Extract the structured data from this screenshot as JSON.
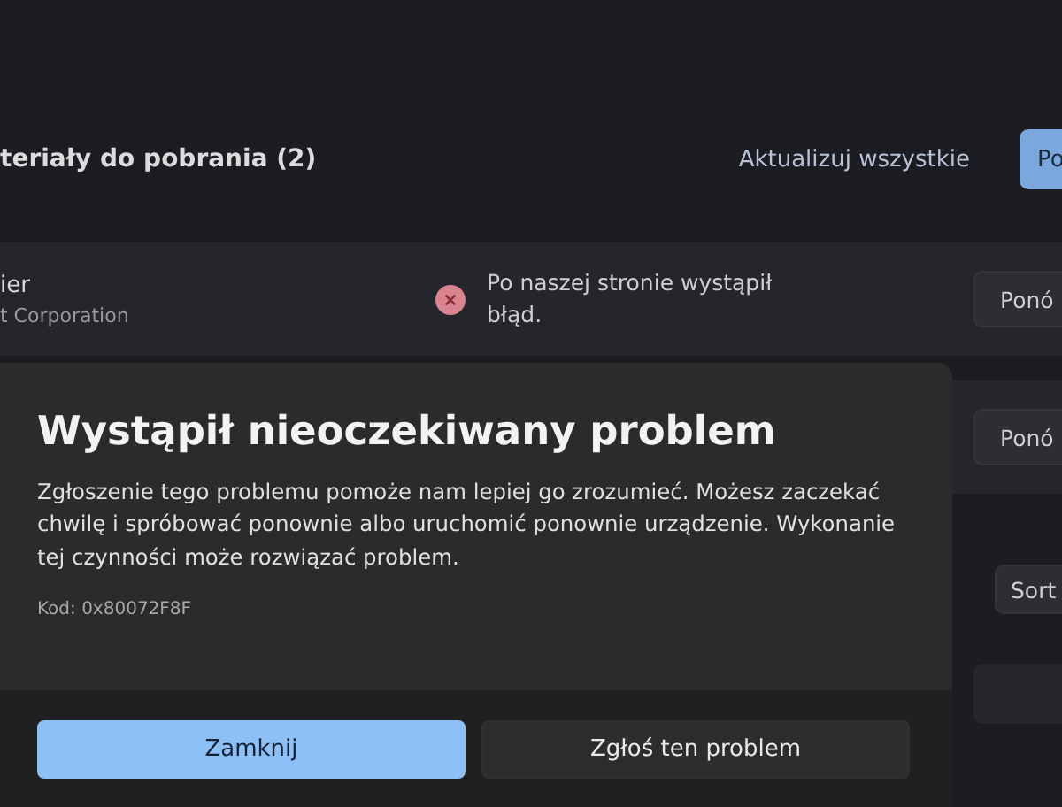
{
  "header": {
    "title": "teriały do pobrania (2)",
    "update_all": "Aktualizuj wszystkie",
    "primary_button": "Po"
  },
  "downloads": [
    {
      "name": "ier",
      "publisher": "t Corporation",
      "kind": "error",
      "message": "Po naszej stronie wystąpił błąd.",
      "action": "Ponó"
    },
    {
      "action": "Ponó"
    }
  ],
  "sort_button": "Sort",
  "dialog": {
    "title": "Wystąpił nieoczekiwany problem",
    "body": "Zgłoszenie tego problemu pomoże nam lepiej go zrozumieć. Możesz zaczekać chwilę i spróbować ponownie albo uruchomić ponownie urządzenie. Wykonanie tej czynności może rozwiązać problem.",
    "code": "Kod: 0x80072F8F",
    "buttons": [
      {
        "label": "Zamknij",
        "primary": true
      },
      {
        "label": "Zgłoś ten problem",
        "primary": false
      }
    ]
  }
}
